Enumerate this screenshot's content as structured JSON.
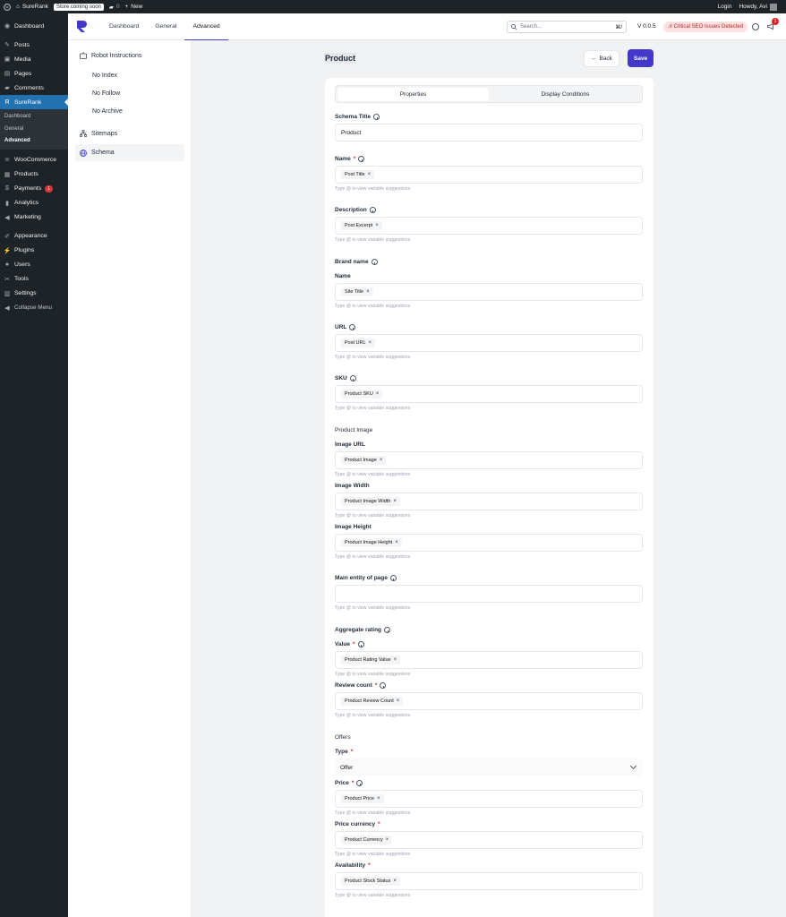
{
  "admin_bar": {
    "site": "SureRank",
    "store_badge": "Store coming soon",
    "comments": "0",
    "new": "New",
    "login": "Login",
    "howdy": "Howdy, Avi"
  },
  "wp_menu": {
    "items": [
      {
        "label": "Dashboard",
        "icon": "dashboard-icon"
      },
      {
        "label": "Posts",
        "icon": "pin-icon"
      },
      {
        "label": "Media",
        "icon": "media-icon"
      },
      {
        "label": "Pages",
        "icon": "pages-icon"
      },
      {
        "label": "Comments",
        "icon": "comments-icon"
      },
      {
        "label": "SureRank",
        "icon": "surerank-icon",
        "active": true
      },
      {
        "label": "WooCommerce",
        "icon": "woo-icon"
      },
      {
        "label": "Products",
        "icon": "products-icon"
      },
      {
        "label": "Payments",
        "icon": "payments-icon",
        "badge": "1"
      },
      {
        "label": "Analytics",
        "icon": "analytics-icon"
      },
      {
        "label": "Marketing",
        "icon": "marketing-icon"
      },
      {
        "label": "Appearance",
        "icon": "appearance-icon"
      },
      {
        "label": "Plugins",
        "icon": "plugins-icon"
      },
      {
        "label": "Users",
        "icon": "users-icon"
      },
      {
        "label": "Tools",
        "icon": "tools-icon"
      },
      {
        "label": "Settings",
        "icon": "settings-icon"
      },
      {
        "label": "Collapse Menu",
        "icon": "collapse-icon"
      }
    ],
    "submenu": [
      "Dashboard",
      "General",
      "Advanced"
    ]
  },
  "top_nav": {
    "tabs": [
      "Dashboard",
      "General",
      "Advanced"
    ],
    "active_tab": "Advanced",
    "search_placeholder": "Search...",
    "shortcut": "⌘/",
    "version": "V 0.0.5",
    "critical": "Critical SEO Issues Detected",
    "notification_count": "1"
  },
  "left_nav": {
    "robot": "Robot Instructions",
    "robot_items": [
      "No Index",
      "No Follow",
      "No Archive"
    ],
    "sitemaps": "Sitemaps",
    "schema": "Schema"
  },
  "page": {
    "title": "Product",
    "back": "Back",
    "save": "Save"
  },
  "tabs": {
    "properties": "Properties",
    "display": "Display Conditions"
  },
  "hint": "Type @ to view variable suggestions",
  "form": {
    "schema_title": {
      "label": "Schema Title",
      "value": "Product"
    },
    "name": {
      "label": "Name",
      "chip": "Post Title"
    },
    "description": {
      "label": "Description",
      "chip": "Post Excerpt"
    },
    "brand": {
      "label": "Brand name",
      "name_label": "Name",
      "chip": "Site Title"
    },
    "url": {
      "label": "URL",
      "chip": "Post URL"
    },
    "sku": {
      "label": "SKU",
      "chip": "Product SKU"
    },
    "image": {
      "label": "Product Image",
      "url_label": "Image URL",
      "url_chip": "Product Image",
      "width_label": "Image Width",
      "width_chip": "Product Image Width",
      "height_label": "Image Height",
      "height_chip": "Product Image Height"
    },
    "main_entity": {
      "label": "Main entity of page",
      "value": ""
    },
    "rating": {
      "label": "Aggregate rating",
      "value_label": "Value",
      "value_chip": "Product Rating Value",
      "count_label": "Review count",
      "count_chip": "Product Review Count"
    },
    "offers": {
      "label": "Offers",
      "type_label": "Type",
      "type_value": "Offer",
      "price_label": "Price",
      "price_chip": "Product Price",
      "currency_label": "Price currency",
      "currency_chip": "Product Currency",
      "availability_label": "Availability",
      "availability_chip": "Product Stock Status"
    }
  },
  "colors": {
    "accent": "#4338ca",
    "wp_dark": "#1d2327",
    "wp_active": "#2271b1",
    "required": "#dc2626"
  }
}
